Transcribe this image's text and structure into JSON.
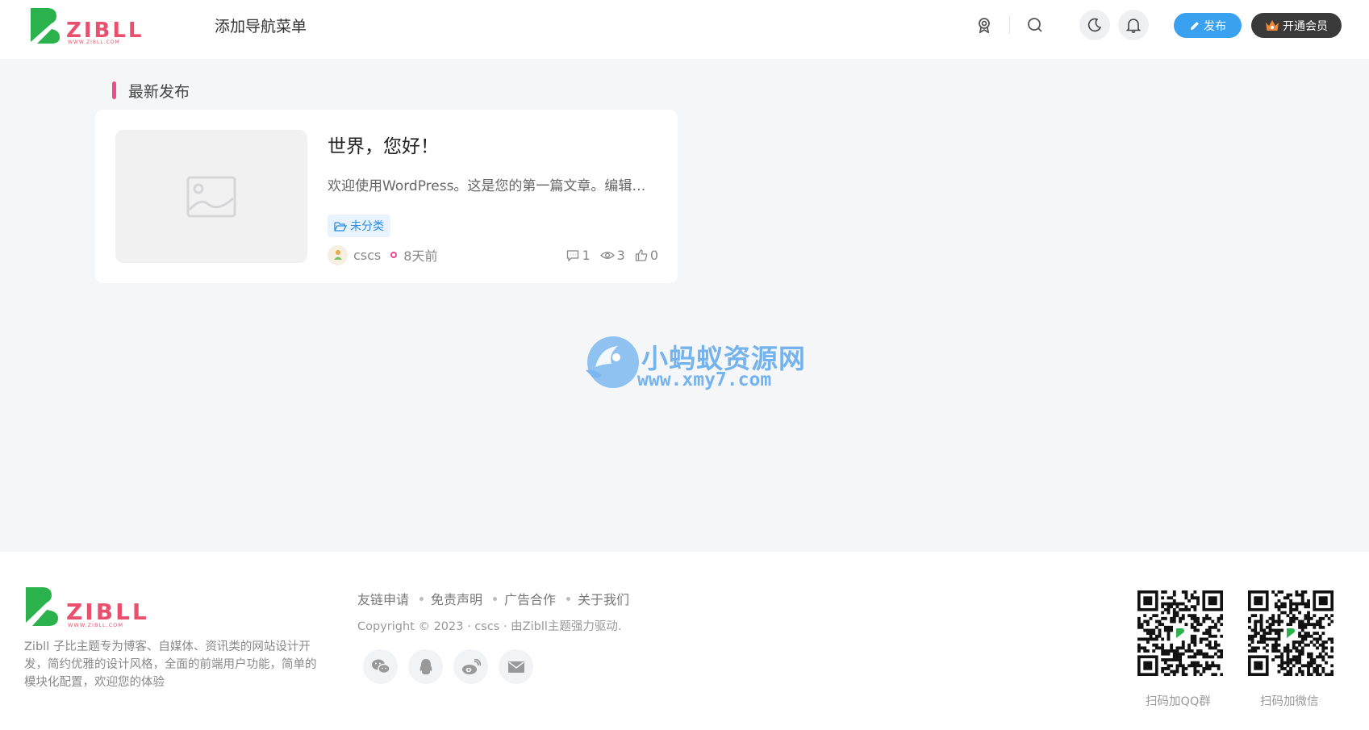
{
  "header": {
    "nav_add_label": "添加导航菜单",
    "publish_label": "发布",
    "vip_label": "开通会员"
  },
  "section": {
    "title": "最新发布"
  },
  "post": {
    "title": "世界，您好！",
    "excerpt": "欢迎使用WordPress。这是您的第一篇文章。编辑…",
    "category": "未分类",
    "author": "cscs",
    "time": "8天前",
    "comments": "1",
    "views": "3",
    "likes": "0"
  },
  "watermark": {
    "cn": "小蚂蚁资源网",
    "en": "www.xmy7.com"
  },
  "footer": {
    "logo_text": "ZIBLL",
    "logo_sub": "WWW.ZIBLL.COM",
    "description": "Zibll 子比主题专为博客、自媒体、资讯类的网站设计开发，简约优雅的设计风格，全面的前端用户功能，简单的模块化配置，欢迎您的体验",
    "links": [
      "友链申请",
      "免责声明",
      "广告合作",
      "关于我们"
    ],
    "copyright": "Copyright © 2023 · cscs · 由Zibll主题强力驱动.",
    "qr_labels": [
      "扫码加QQ群",
      "扫码加微信"
    ]
  },
  "colors": {
    "brand_green": "#2bb24c",
    "brand_pink": "#e8506e",
    "accent_pink": "#ee4b8a",
    "publish_blue": "#3aa1f0",
    "vip_dark": "#3a3a3a"
  }
}
